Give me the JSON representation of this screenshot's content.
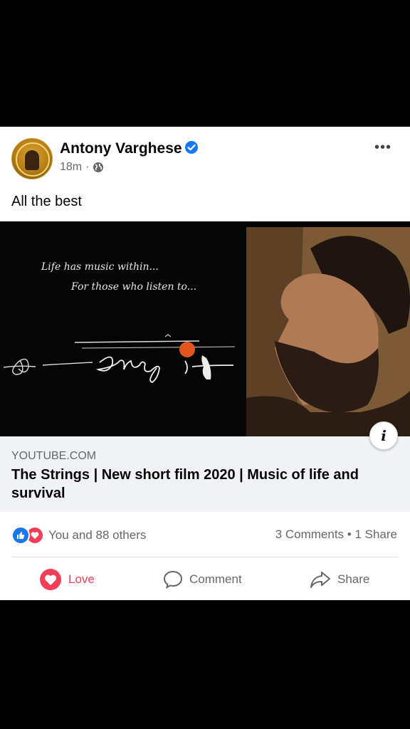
{
  "post": {
    "author": "Antony Varghese",
    "time": "18m",
    "separator": "·",
    "text": "All the best",
    "more_label": "•••"
  },
  "link": {
    "domain": "YOUTUBE.COM",
    "title": "The Strings | New short film 2020 | Music of life and survival",
    "tagline_line1": "Life has music within...",
    "tagline_line2": "For those who listen to...",
    "info_label": "i"
  },
  "engagement": {
    "reactions_text": "You and 88 others",
    "stats_text": "3 Comments • 1 Share"
  },
  "actions": {
    "love": "Love",
    "comment": "Comment",
    "share": "Share"
  },
  "colors": {
    "love": "#f33e58",
    "like": "#1877f2",
    "verified": "#1877f2"
  },
  "icons": [
    "verified-icon",
    "globe-icon",
    "more-options-icon",
    "info-icon",
    "like-reaction-icon",
    "love-reaction-icon",
    "love-action-icon",
    "comment-icon",
    "share-icon"
  ]
}
